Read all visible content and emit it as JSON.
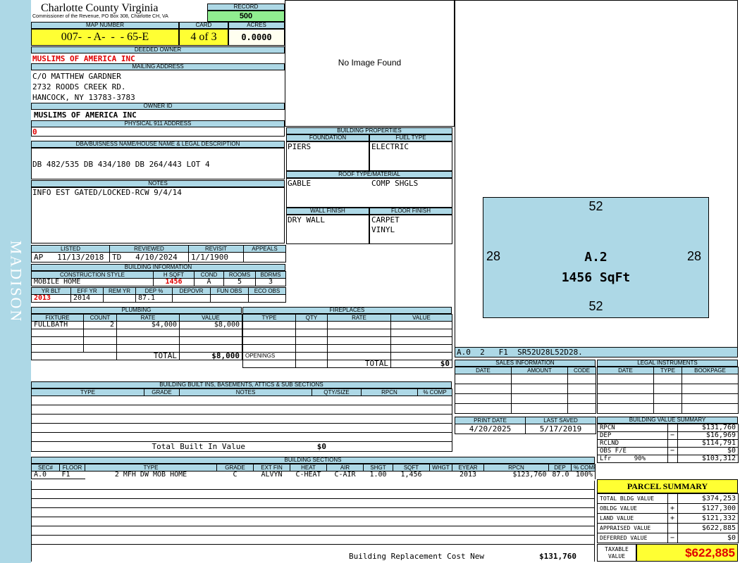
{
  "county": "Charlotte County Virginia",
  "commissioner": "Commissioner of the Revenue, PO Box 308, Charlotte CH, VA",
  "side_label": "MADISON",
  "record": {
    "label": "RECORD",
    "value": "500"
  },
  "map": {
    "label": "MAP NUMBER",
    "value": "007-  - A-  -  - 65-E"
  },
  "card": {
    "label": "CARD",
    "value": "4 of 3"
  },
  "acres": {
    "label": "ACRES",
    "value": "0.0000"
  },
  "deeded_owner": {
    "label": "DEEDED OWNER",
    "value": "MUSLIMS OF AMERICA INC"
  },
  "mailing": {
    "label": "MAILING ADDRESS",
    "line1": "C/O MATTHEW GARDNER",
    "line2": "2732 ROODS CREEK RD.",
    "line3": "HANCOCK, NY 13783-3783"
  },
  "owner_id": {
    "label": "OWNER ID",
    "value": "MUSLIMS OF AMERICA INC"
  },
  "physical": {
    "label": "PHYSICAL 911 ADDRESS",
    "value": "0"
  },
  "dba": {
    "label": "DBA/BUISNESS NAME/HOUSE NAME & LEGAL DESCRIPTION",
    "value": "DB 482/535 DB 434/180 DB 264/443 LOT 4"
  },
  "notes": {
    "label": "NOTES",
    "value": "INFO EST GATED/LOCKED-RCW 9/4/14"
  },
  "image": {
    "text": "No Image Found"
  },
  "bp": {
    "label": "BUILDING PROPERTIES",
    "foundation_label": "FOUNDATION",
    "fuel_label": "FUEL TYPE",
    "foundation": "PIERS",
    "fuel": "ELECTRIC",
    "roof_label": "ROOF TYPE/MATERIAL",
    "roof1": "GABLE",
    "roof2": "COMP SHGLS",
    "wall_label": "WALL FINISH",
    "floor_label": "FLOOR FINISH",
    "wall": "DRY WALL",
    "floor1": "CARPET",
    "floor2": "VINYL"
  },
  "sketch": {
    "top": "52",
    "bottom": "52",
    "left": "28",
    "right": "28",
    "label": "A.2",
    "sqft": "1456 SqFt",
    "code": "A.0  2   F1  SR52U28L52D28."
  },
  "listing": {
    "listed_label": "LISTED",
    "reviewed_label": "REVIEWED",
    "revisit_label": "REVISIT",
    "appeals_label": "APPEALS",
    "lister": "AP",
    "listed": "11/13/2018",
    "reviewer": "TD",
    "reviewed": "4/10/2024",
    "revisit": "1/1/1900",
    "appeals": ""
  },
  "bi": {
    "label": "BUILDING INFORMATION",
    "style_label": "CONSTRUCTION STYLE",
    "hsqft_label": "H SQFT",
    "cond_label": "COND",
    "rooms_label": "ROOMS",
    "bdrms_label": "BDRMS",
    "style": "MOBILE HOME",
    "hsqft": "1456",
    "cond": "A",
    "rooms": "5",
    "bdrms": "3",
    "yrblt_label": "YR BLT",
    "effyr_label": "EFF YR",
    "remyr_label": "REM YR",
    "dep_label": "DEP %",
    "depovr_label": "DEPOVR",
    "funobs_label": "FUN OBS",
    "ecoobs_label": "ECO OBS",
    "yrblt": "2013",
    "effyr": "2014",
    "remyr": "",
    "dep": "87.1",
    "depovr": "",
    "funobs": "",
    "ecoobs": ""
  },
  "plumbing": {
    "label": "PLUMBING",
    "headers": [
      "FIXTURE",
      "COUNT",
      "RATE",
      "VALUE"
    ],
    "rows": [
      [
        "FULLBATH",
        "2",
        "$4,000",
        "$8,000"
      ]
    ],
    "total_label": "TOTAL",
    "total": "$8,000"
  },
  "fireplaces": {
    "label": "FIREPLACES",
    "headers": [
      "TYPE",
      "QTY",
      "RATE",
      "VALUE"
    ],
    "openings": "OPENINGS",
    "total_label": "TOTAL",
    "total": "$0"
  },
  "sales": {
    "label": "SALES INFORMATION",
    "headers": [
      "DATE",
      "AMOUNT",
      "CODE"
    ]
  },
  "legal": {
    "label": "LEGAL INSTRUMENTS",
    "headers": [
      "DATE",
      "TYPE",
      "BOOKPAGE"
    ]
  },
  "builtins": {
    "label": "BUILDING BUILT INS, BASEMENTS, ATTICS & SUB SECTIONS",
    "headers": [
      "TYPE",
      "GRADE",
      "NOTES",
      "QTY/SIZE",
      "RPCN",
      "% COMP"
    ],
    "total_label": "Total Built In Value",
    "total": "$0"
  },
  "dates": {
    "print_label": "PRINT DATE",
    "saved_label": "LAST SAVED",
    "print": "4/20/2025",
    "saved": "5/17/2019"
  },
  "bvs": {
    "label": "BUILDING VALUE SUMMARY",
    "rows": [
      [
        "RPCN",
        "",
        "$131,760"
      ],
      [
        "DEP",
        "−",
        "$16,969"
      ],
      [
        "RCLND",
        "",
        "$114,791"
      ],
      [
        "OBS F/E",
        "−",
        "$0"
      ],
      [
        "Lfr      90%",
        "",
        "$103,312"
      ]
    ]
  },
  "sections": {
    "label": "BUILDING SECTIONS",
    "headers": [
      "SEC#",
      "FLOOR",
      "TYPE",
      "GRADE",
      "EXT FIN",
      "HEAT",
      "AIR",
      "SHGT",
      "SQFT",
      "WHGT",
      "EYEAR",
      "RPCN",
      "DEP",
      "% COMP"
    ],
    "rows": [
      [
        "A.0",
        "F1",
        "2 MFH DW MOB HOME",
        "C",
        "ALVYN",
        "C-HEAT",
        "C-AIR",
        "1.00",
        "1,456",
        "",
        "2013",
        "$123,760",
        "87.0",
        "100%"
      ]
    ],
    "rcn_label": "Building Replacement Cost New",
    "rcn": "$131,760"
  },
  "parcel": {
    "label": "PARCEL SUMMARY",
    "rows": [
      [
        "TOTAL BLDG VALUE",
        "",
        "$374,253"
      ],
      [
        "OBLDG VALUE",
        "+",
        "$127,300"
      ],
      [
        "LAND VALUE",
        "+",
        "$121,332"
      ],
      [
        "APPRAISED VALUE",
        "",
        "$622,885"
      ],
      [
        "DEFERRED VALUE",
        "−",
        "$0"
      ]
    ],
    "taxable_label1": "TAXABLE",
    "taxable_label2": "VALUE",
    "taxable": "$622,885"
  },
  "colors": {
    "header": "#add8e6",
    "yellow": "#ffff33",
    "green": "#90ee90",
    "red": "#e00000"
  }
}
